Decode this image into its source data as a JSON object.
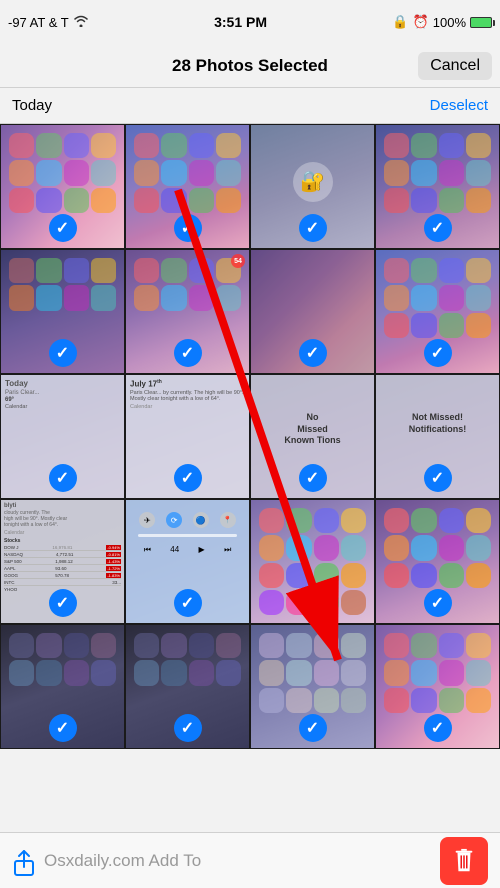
{
  "statusBar": {
    "carrier": "-97 AT & T",
    "signal_icon": "wifi-icon",
    "time": "3:51 PM",
    "lock_icon": "lock-icon",
    "alarm_icon": "alarm-icon",
    "battery": "100%",
    "battery_icon": "battery-icon"
  },
  "header": {
    "title": "28 Photos Selected",
    "cancel_label": "Cancel"
  },
  "section": {
    "title": "Today",
    "deselect_label": "Deselect"
  },
  "toolbar": {
    "add_to_label": "Osxdaily.com  Add To",
    "share_label": "Share",
    "delete_label": "Delete"
  },
  "grid": {
    "rows": 5,
    "cols": 4,
    "all_selected": true
  }
}
